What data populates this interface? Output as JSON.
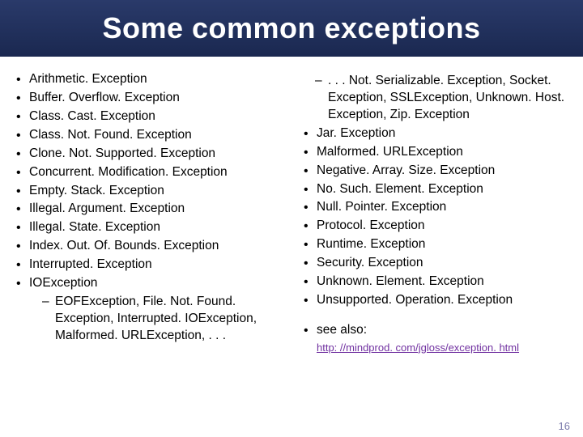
{
  "title": "Some common exceptions",
  "left": {
    "items": [
      "Arithmetic. Exception",
      "Buffer. Overflow. Exception",
      "Class. Cast. Exception",
      "Class. Not. Found. Exception",
      "Clone. Not. Supported. Exception",
      "Concurrent. Modification. Exception",
      "Empty. Stack. Exception",
      "Illegal. Argument. Exception",
      "Illegal. State. Exception",
      "Index. Out. Of. Bounds. Exception",
      "Interrupted. Exception",
      "IOException"
    ],
    "sub": "EOFException, File. Not. Found. Exception, Interrupted. IOException, Malformed. URLException, . . ."
  },
  "right": {
    "sub": ". . . Not. Serializable. Exception, Socket. Exception, SSLException, Unknown. Host. Exception, Zip. Exception",
    "items": [
      "Jar. Exception",
      "Malformed. URLException",
      "Negative. Array. Size. Exception",
      "No. Such. Element. Exception",
      "Null. Pointer. Exception",
      "Protocol. Exception",
      "Runtime. Exception",
      "Security. Exception",
      "Unknown. Element. Exception",
      "Unsupported. Operation. Exception"
    ],
    "see_also_label": "see also:",
    "see_also_url": "http: //mindprod. com/jgloss/exception. html"
  },
  "page_number": "16"
}
